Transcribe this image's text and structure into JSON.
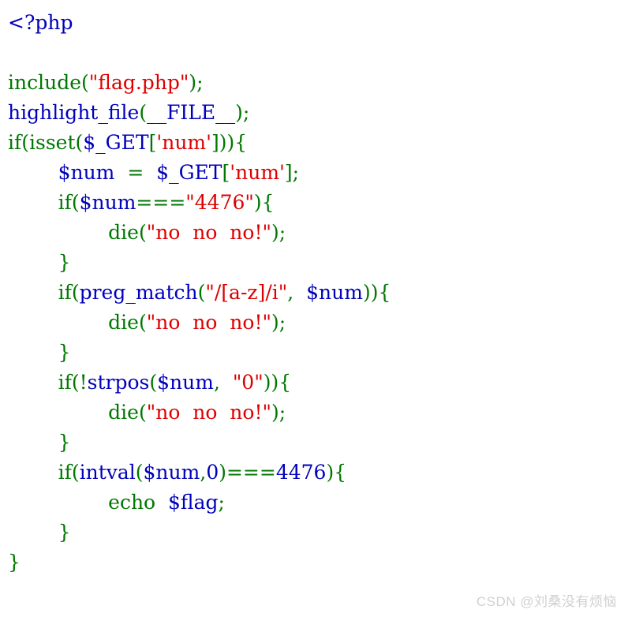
{
  "page": {
    "kind": "php-source-listing",
    "background_color": "#ffffff"
  },
  "colors": {
    "default": "#0000BB",
    "keyword": "#007700",
    "string": "#DD0000",
    "watermark": "#d0d0d0",
    "background": "#ffffff"
  },
  "code": {
    "language": "php",
    "lines": [
      {
        "index": 1,
        "text": "<?php",
        "tokens": [
          {
            "t": "<?php",
            "c": "tag"
          }
        ]
      },
      {
        "index": 2,
        "text": "",
        "tokens": []
      },
      {
        "index": 3,
        "text": "include(\"flag.php\");",
        "tokens": [
          {
            "t": "include",
            "c": "keyword"
          },
          {
            "t": "(",
            "c": "keyword"
          },
          {
            "t": "\"flag.php\"",
            "c": "string"
          },
          {
            "t": ")",
            "c": "keyword"
          },
          {
            "t": ";",
            "c": "keyword"
          }
        ]
      },
      {
        "index": 4,
        "text": "highlight_file(__FILE__);",
        "tokens": [
          {
            "t": "highlight_file",
            "c": "default"
          },
          {
            "t": "(",
            "c": "keyword"
          },
          {
            "t": "__FILE__",
            "c": "default"
          },
          {
            "t": ")",
            "c": "keyword"
          },
          {
            "t": ";",
            "c": "keyword"
          }
        ]
      },
      {
        "index": 5,
        "text": "if(isset($_GET['num'])){",
        "tokens": [
          {
            "t": "if",
            "c": "keyword"
          },
          {
            "t": "(",
            "c": "keyword"
          },
          {
            "t": "isset",
            "c": "keyword"
          },
          {
            "t": "(",
            "c": "keyword"
          },
          {
            "t": "$_GET",
            "c": "default"
          },
          {
            "t": "[",
            "c": "keyword"
          },
          {
            "t": "'num'",
            "c": "string"
          },
          {
            "t": "]",
            "c": "keyword"
          },
          {
            "t": "))",
            "c": "keyword"
          },
          {
            "t": "{",
            "c": "keyword"
          }
        ]
      },
      {
        "index": 6,
        "text": "        $num  =  $_GET['num'];",
        "tokens": [
          {
            "t": "        ",
            "c": "keyword"
          },
          {
            "t": "$num",
            "c": "default"
          },
          {
            "t": "  ",
            "c": "keyword"
          },
          {
            "t": "=",
            "c": "keyword"
          },
          {
            "t": "  ",
            "c": "keyword"
          },
          {
            "t": "$_GET",
            "c": "default"
          },
          {
            "t": "[",
            "c": "keyword"
          },
          {
            "t": "'num'",
            "c": "string"
          },
          {
            "t": "]",
            "c": "keyword"
          },
          {
            "t": ";",
            "c": "keyword"
          }
        ]
      },
      {
        "index": 7,
        "text": "        if($num===\"4476\"){",
        "tokens": [
          {
            "t": "        ",
            "c": "keyword"
          },
          {
            "t": "if",
            "c": "keyword"
          },
          {
            "t": "(",
            "c": "keyword"
          },
          {
            "t": "$num",
            "c": "default"
          },
          {
            "t": "===",
            "c": "keyword"
          },
          {
            "t": "\"4476\"",
            "c": "string"
          },
          {
            "t": ")",
            "c": "keyword"
          },
          {
            "t": "{",
            "c": "keyword"
          }
        ]
      },
      {
        "index": 8,
        "text": "                die(\"no  no  no!\");",
        "tokens": [
          {
            "t": "                ",
            "c": "keyword"
          },
          {
            "t": "die",
            "c": "keyword"
          },
          {
            "t": "(",
            "c": "keyword"
          },
          {
            "t": "\"no  no  no!\"",
            "c": "string"
          },
          {
            "t": ")",
            "c": "keyword"
          },
          {
            "t": ";",
            "c": "keyword"
          }
        ]
      },
      {
        "index": 9,
        "text": "        }",
        "tokens": [
          {
            "t": "        ",
            "c": "keyword"
          },
          {
            "t": "}",
            "c": "keyword"
          }
        ]
      },
      {
        "index": 10,
        "text": "        if(preg_match(\"/[a-z]/i\",  $num)){",
        "tokens": [
          {
            "t": "        ",
            "c": "keyword"
          },
          {
            "t": "if",
            "c": "keyword"
          },
          {
            "t": "(",
            "c": "keyword"
          },
          {
            "t": "preg_match",
            "c": "default"
          },
          {
            "t": "(",
            "c": "keyword"
          },
          {
            "t": "\"/[a-z]/i\"",
            "c": "string"
          },
          {
            "t": ",",
            "c": "keyword"
          },
          {
            "t": "  ",
            "c": "keyword"
          },
          {
            "t": "$num",
            "c": "default"
          },
          {
            "t": "))",
            "c": "keyword"
          },
          {
            "t": "{",
            "c": "keyword"
          }
        ]
      },
      {
        "index": 11,
        "text": "                die(\"no  no  no!\");",
        "tokens": [
          {
            "t": "                ",
            "c": "keyword"
          },
          {
            "t": "die",
            "c": "keyword"
          },
          {
            "t": "(",
            "c": "keyword"
          },
          {
            "t": "\"no  no  no!\"",
            "c": "string"
          },
          {
            "t": ")",
            "c": "keyword"
          },
          {
            "t": ";",
            "c": "keyword"
          }
        ]
      },
      {
        "index": 12,
        "text": "        }",
        "tokens": [
          {
            "t": "        ",
            "c": "keyword"
          },
          {
            "t": "}",
            "c": "keyword"
          }
        ]
      },
      {
        "index": 13,
        "text": "        if(!strpos($num,  \"0\")){",
        "tokens": [
          {
            "t": "        ",
            "c": "keyword"
          },
          {
            "t": "if",
            "c": "keyword"
          },
          {
            "t": "(",
            "c": "keyword"
          },
          {
            "t": "!",
            "c": "keyword"
          },
          {
            "t": "strpos",
            "c": "default"
          },
          {
            "t": "(",
            "c": "keyword"
          },
          {
            "t": "$num",
            "c": "default"
          },
          {
            "t": ",",
            "c": "keyword"
          },
          {
            "t": "  ",
            "c": "keyword"
          },
          {
            "t": "\"0\"",
            "c": "string"
          },
          {
            "t": "))",
            "c": "keyword"
          },
          {
            "t": "{",
            "c": "keyword"
          }
        ]
      },
      {
        "index": 14,
        "text": "                die(\"no  no  no!\");",
        "tokens": [
          {
            "t": "                ",
            "c": "keyword"
          },
          {
            "t": "die",
            "c": "keyword"
          },
          {
            "t": "(",
            "c": "keyword"
          },
          {
            "t": "\"no  no  no!\"",
            "c": "string"
          },
          {
            "t": ")",
            "c": "keyword"
          },
          {
            "t": ";",
            "c": "keyword"
          }
        ]
      },
      {
        "index": 15,
        "text": "        }",
        "tokens": [
          {
            "t": "        ",
            "c": "keyword"
          },
          {
            "t": "}",
            "c": "keyword"
          }
        ]
      },
      {
        "index": 16,
        "text": "        if(intval($num,0)===4476){",
        "tokens": [
          {
            "t": "        ",
            "c": "keyword"
          },
          {
            "t": "if",
            "c": "keyword"
          },
          {
            "t": "(",
            "c": "keyword"
          },
          {
            "t": "intval",
            "c": "default"
          },
          {
            "t": "(",
            "c": "keyword"
          },
          {
            "t": "$num",
            "c": "default"
          },
          {
            "t": ",",
            "c": "keyword"
          },
          {
            "t": "0",
            "c": "default"
          },
          {
            "t": ")",
            "c": "keyword"
          },
          {
            "t": "===",
            "c": "keyword"
          },
          {
            "t": "4476",
            "c": "default"
          },
          {
            "t": ")",
            "c": "keyword"
          },
          {
            "t": "{",
            "c": "keyword"
          }
        ]
      },
      {
        "index": 17,
        "text": "                echo  $flag;",
        "tokens": [
          {
            "t": "                ",
            "c": "keyword"
          },
          {
            "t": "echo",
            "c": "keyword"
          },
          {
            "t": "  ",
            "c": "keyword"
          },
          {
            "t": "$flag",
            "c": "default"
          },
          {
            "t": ";",
            "c": "keyword"
          }
        ]
      },
      {
        "index": 18,
        "text": "        }",
        "tokens": [
          {
            "t": "        ",
            "c": "keyword"
          },
          {
            "t": "}",
            "c": "keyword"
          }
        ]
      },
      {
        "index": 19,
        "text": "}",
        "tokens": [
          {
            "t": "}",
            "c": "keyword"
          }
        ]
      }
    ]
  },
  "watermark": {
    "text": "CSDN @刘桑没有烦恼"
  }
}
